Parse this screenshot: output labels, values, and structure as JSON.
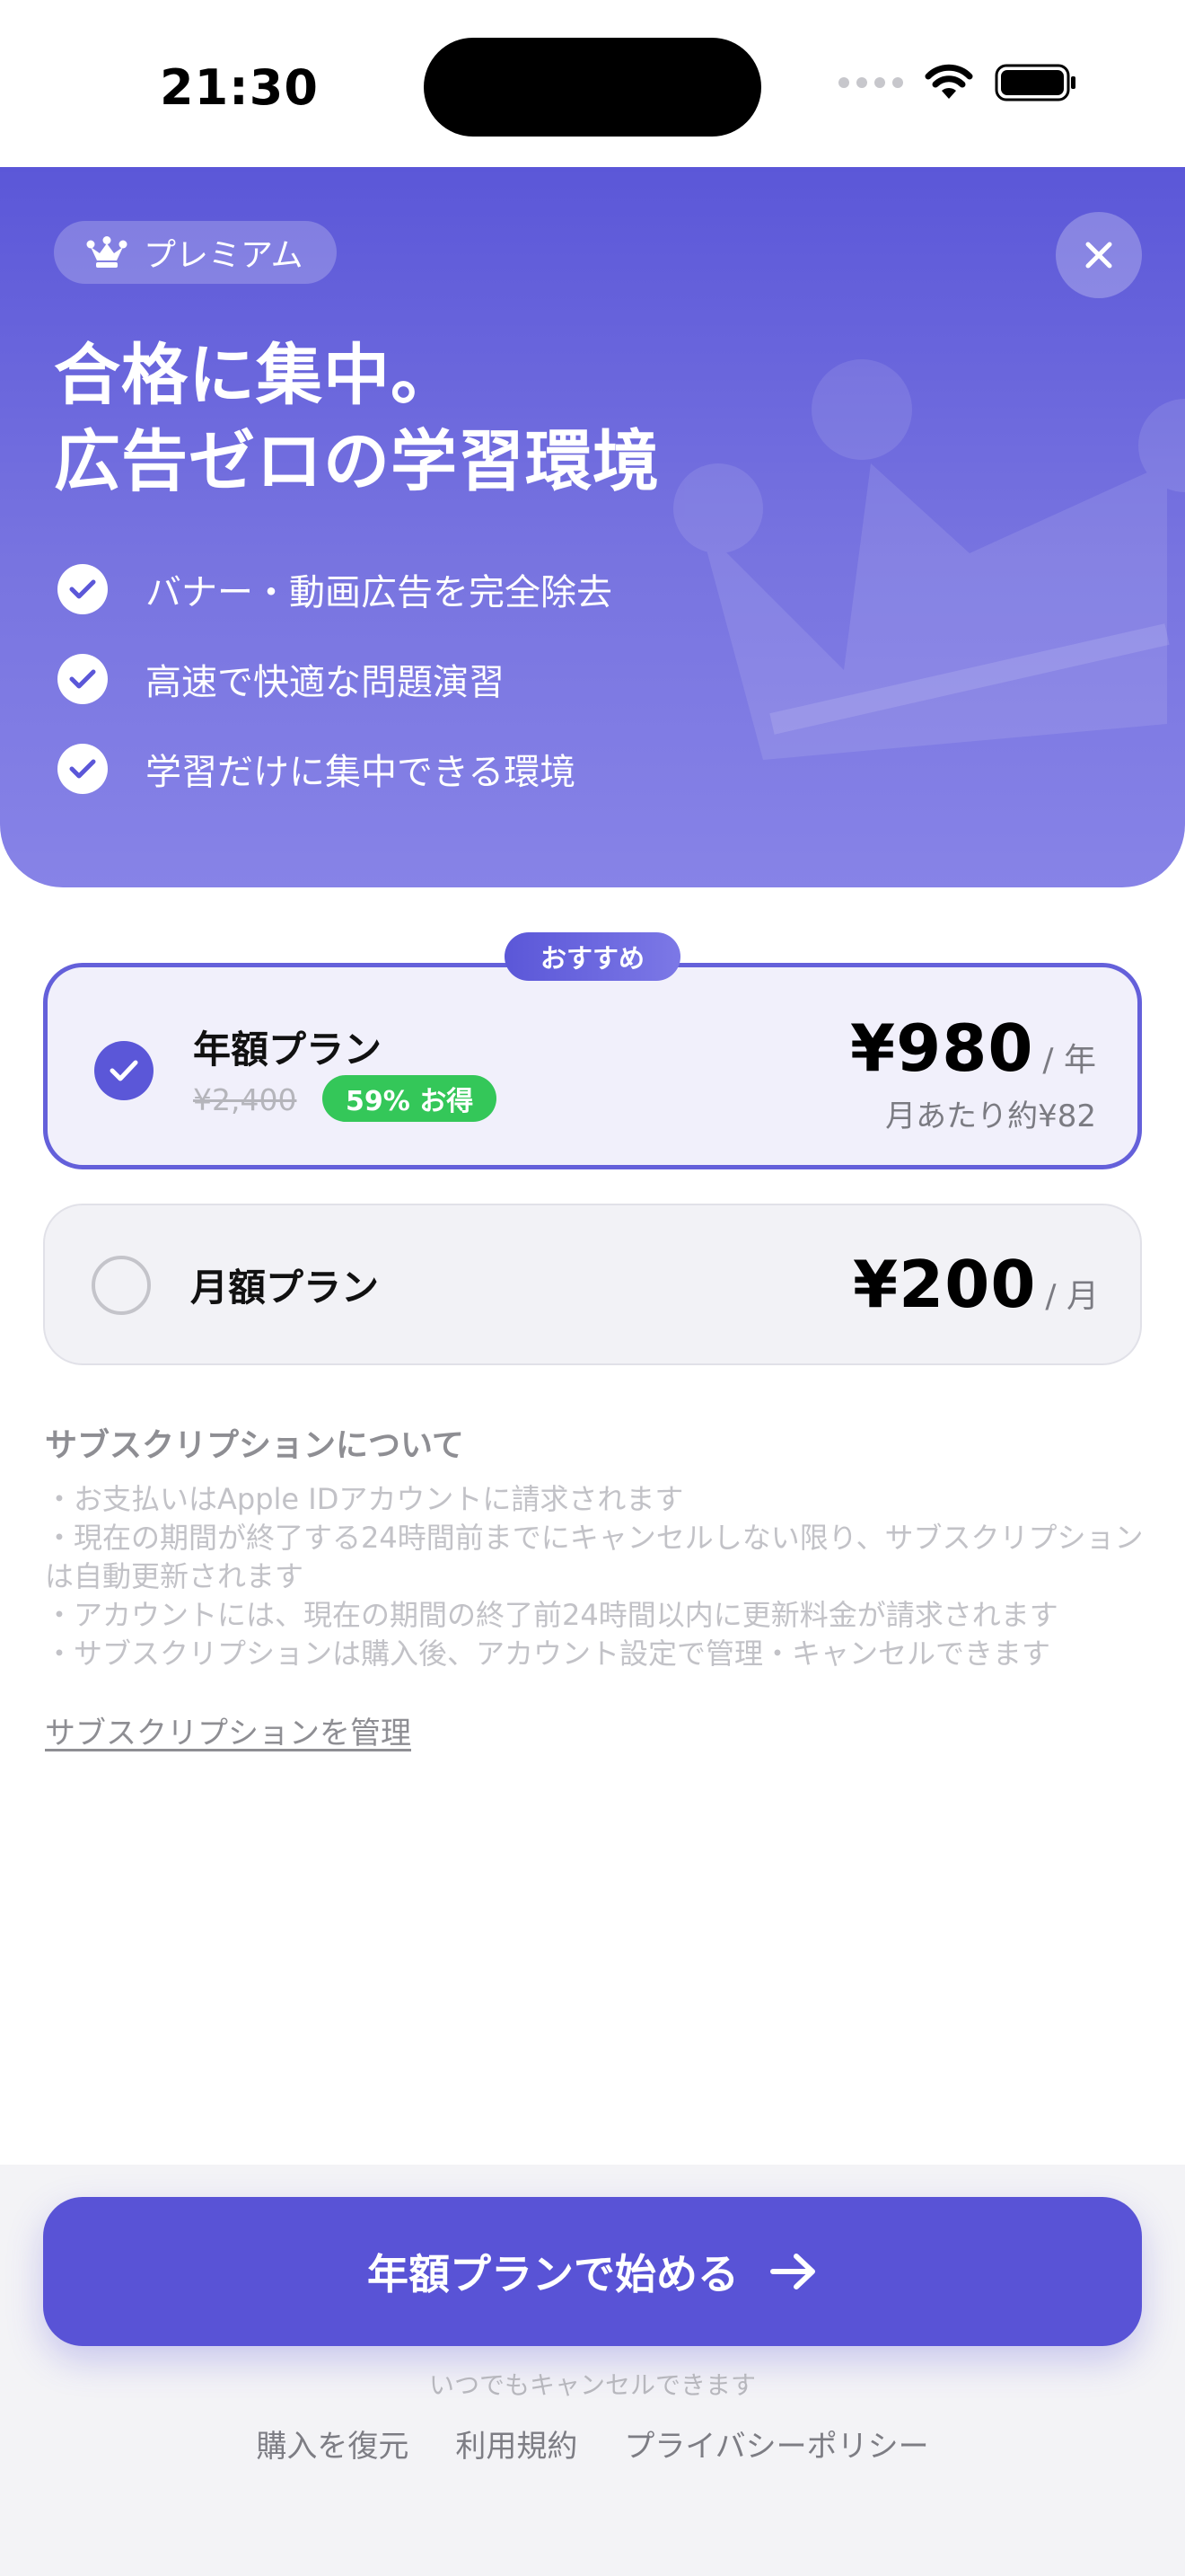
{
  "status_bar": {
    "time": "21:30"
  },
  "hero": {
    "badge_label": "プレミアム",
    "title_line1": "合格に集中。",
    "title_line2": "広告ゼロの学習環境",
    "features": [
      "バナー・動画広告を完全除去",
      "高速で快適な問題演習",
      "学習だけに集中できる環境"
    ]
  },
  "plans": {
    "recommended_label": "おすすめ",
    "annual": {
      "name": "年額プラン",
      "original_price": "¥2,400",
      "save_badge": "59% お得",
      "price": "¥980",
      "unit": "/ 年",
      "per_month": "月あたり約¥82",
      "selected": true
    },
    "monthly": {
      "name": "月額プラン",
      "price": "¥200",
      "unit": "/ 月",
      "selected": false
    }
  },
  "subscription_info": {
    "heading": "サブスクリプションについて",
    "lines": [
      "・お支払いはApple IDアカウントに請求されます",
      "・現在の期間が終了する24時間前までにキャンセルしない限り、サブスクリプションは自動更新されます",
      "・アカウントには、現在の期間の終了前24時間以内に更新料金が請求されます",
      "・サブスクリプションは購入後、アカウント設定で管理・キャンセルできます"
    ],
    "manage_link": "サブスクリプションを管理"
  },
  "footer": {
    "cta_label": "年額プランで始める",
    "cancel_note": "いつでもキャンセルできます",
    "links": [
      "購入を復元",
      "利用規約",
      "プライバシーポリシー"
    ]
  },
  "colors": {
    "accent": "#5b57d8",
    "save_green": "#34c759",
    "hero_gradient_top": "#5b57d8",
    "hero_gradient_bottom": "#8783e7"
  },
  "icons": {
    "crown": "crown-icon",
    "close": "close-icon",
    "check": "checkmark-icon",
    "arrow": "arrow-right-icon",
    "wifi": "wifi-icon",
    "battery": "battery-icon"
  }
}
